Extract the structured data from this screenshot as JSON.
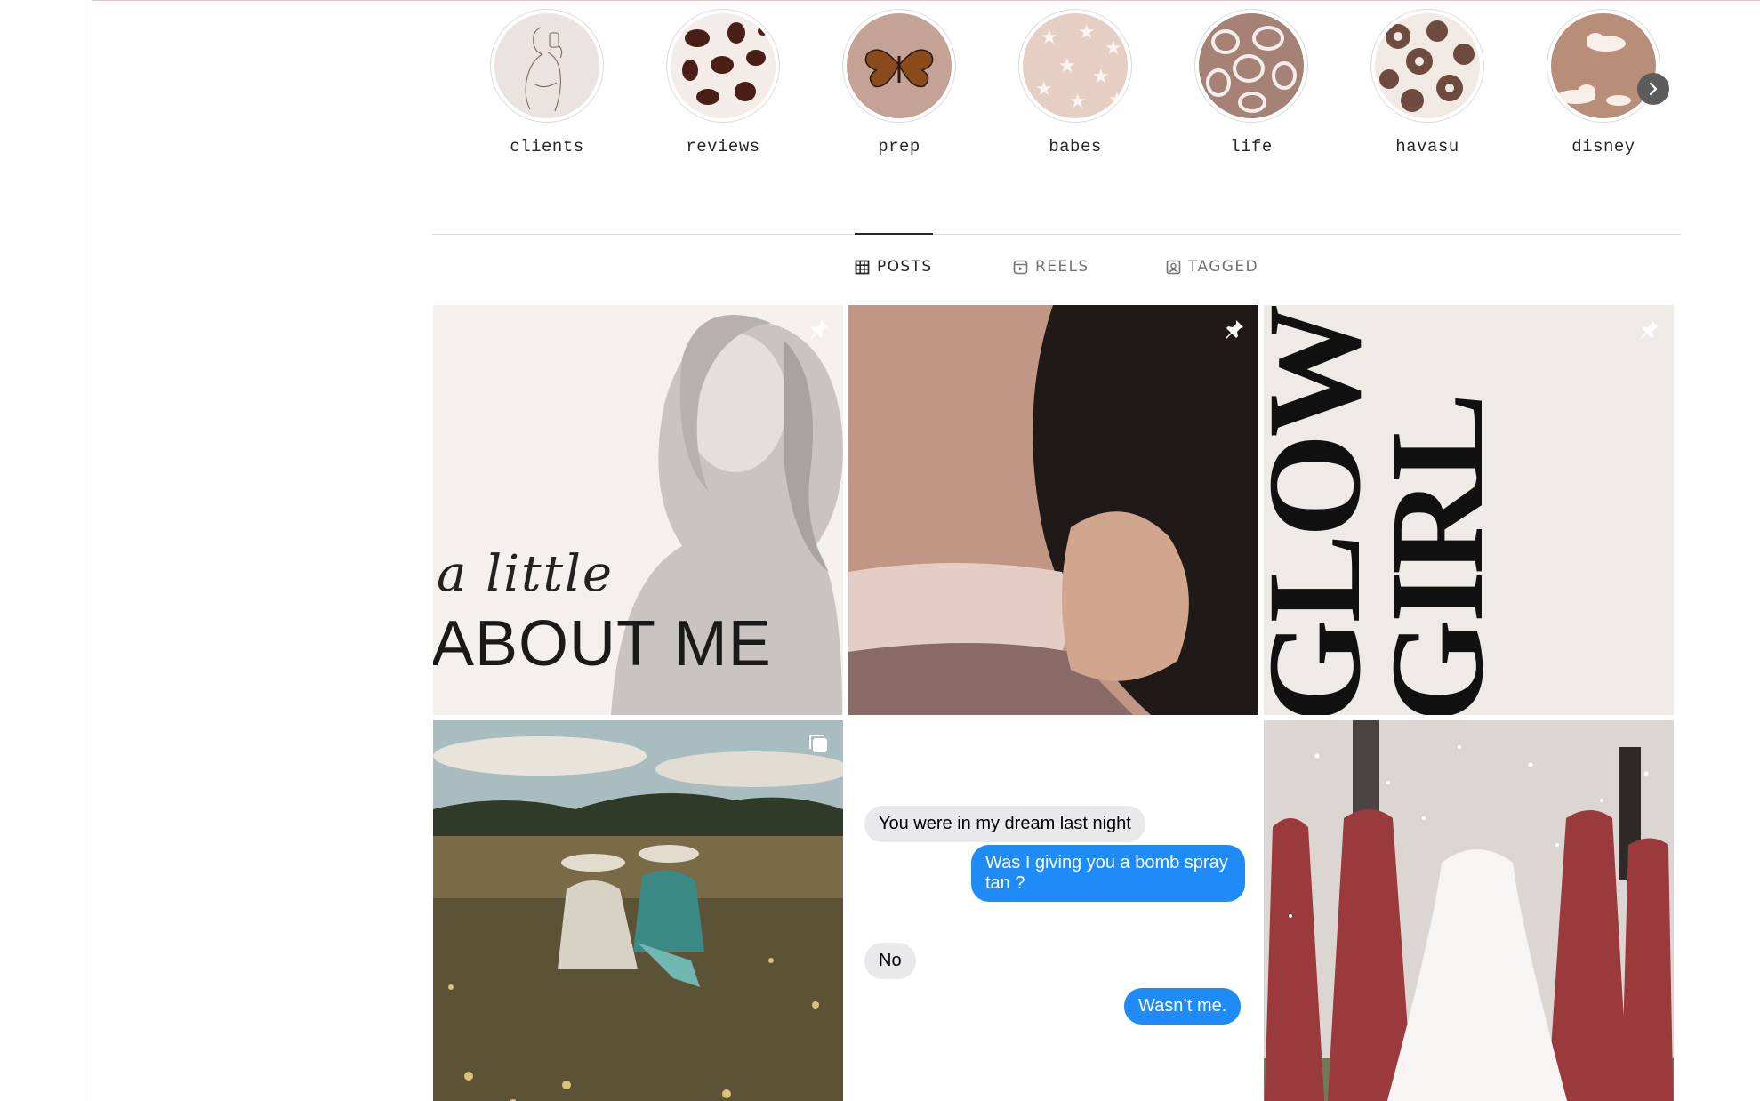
{
  "highlights": [
    {
      "label": "clients",
      "icon": "line-art-selfie"
    },
    {
      "label": "reviews",
      "icon": "cow-print"
    },
    {
      "label": "prep",
      "icon": "butterfly"
    },
    {
      "label": "babes",
      "icon": "stars"
    },
    {
      "label": "life",
      "icon": "smiley-pattern"
    },
    {
      "label": "havasu",
      "icon": "leopard-print"
    },
    {
      "label": "disney",
      "icon": "clouds"
    }
  ],
  "tabs": [
    {
      "label": "POSTS",
      "icon": "grid-icon",
      "active": true
    },
    {
      "label": "REELS",
      "icon": "reels-icon",
      "active": false
    },
    {
      "label": "TAGGED",
      "icon": "tagged-icon",
      "active": false
    }
  ],
  "posts": [
    {
      "type": "image",
      "pinned": true,
      "text_script": "a little",
      "text_title": "ABOUT ME"
    },
    {
      "type": "image",
      "pinned": true
    },
    {
      "type": "image",
      "pinned": true,
      "text_line1": "GLOW",
      "text_line2": "GIRL"
    },
    {
      "type": "carousel",
      "pinned": false
    },
    {
      "type": "image",
      "pinned": false,
      "messages": [
        {
          "dir": "in",
          "text": "You were in my dream last night"
        },
        {
          "dir": "out",
          "text": "Was I giving you a bomb spray tan ?"
        },
        {
          "dir": "in",
          "text": "No"
        },
        {
          "dir": "out",
          "text": "Wasn’t me."
        }
      ]
    },
    {
      "type": "image",
      "pinned": false
    }
  ],
  "colors": {
    "accent_blue": "#1f8bf7",
    "highlight_brown": "#6e4a3f",
    "divider": "#dbdbdb"
  }
}
